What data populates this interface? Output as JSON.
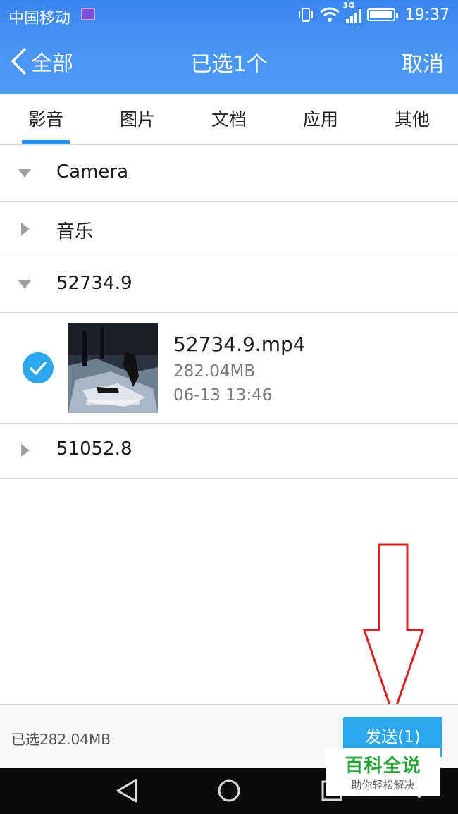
{
  "status_bar": {
    "carrier": "中国移动",
    "network": "3G",
    "time": "19:37"
  },
  "header": {
    "back_label": "全部",
    "title": "已选1个",
    "cancel_label": "取消",
    "background_color": "#4a96f4"
  },
  "tabs": [
    {
      "label": "影音",
      "active": true
    },
    {
      "label": "图片",
      "active": false
    },
    {
      "label": "文档",
      "active": false
    },
    {
      "label": "应用",
      "active": false
    },
    {
      "label": "其他",
      "active": false
    }
  ],
  "folders": [
    {
      "name": "Camera",
      "expanded": true
    },
    {
      "name": "音乐",
      "expanded": false
    },
    {
      "name": "52734.9",
      "expanded": true
    },
    {
      "name": "51052.8",
      "expanded": false
    }
  ],
  "file": {
    "name": "52734.9.mp4",
    "size": "282.04MB",
    "date": "06-13 13:46",
    "checked": true
  },
  "footer": {
    "selected_size": "已选282.04MB",
    "send_label": "发送(1)",
    "accent_color": "#2aa7ee"
  },
  "watermark": {
    "title": "百科全说",
    "subtitle": "助你轻松解决"
  },
  "icons": [
    "back-chevron-icon",
    "vibrate-icon",
    "wifi-icon",
    "signal-icon",
    "battery-icon",
    "expand-triangle-icon",
    "check-icon",
    "back-nav-icon",
    "home-nav-icon",
    "recents-nav-icon",
    "red-down-arrow"
  ]
}
